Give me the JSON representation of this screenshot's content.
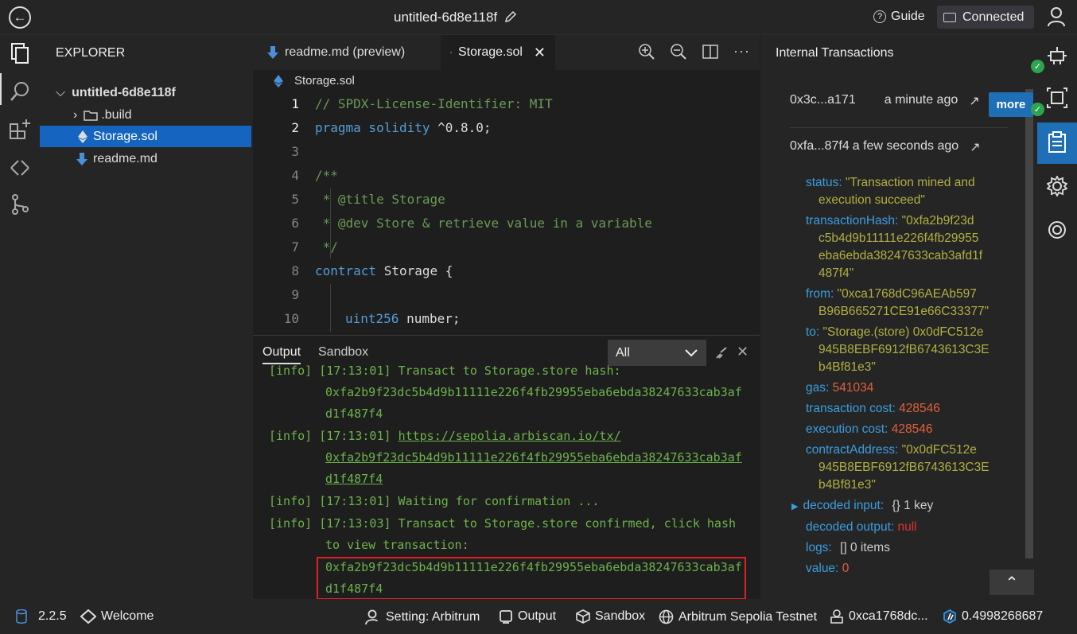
{
  "header": {
    "title": "untitled-6d8e118f",
    "guide_label": "Guide",
    "connected_label": "Connected"
  },
  "explorer": {
    "heading": "EXPLORER",
    "workspace": "untitled-6d8e118f",
    "items": [
      {
        "label": ".build"
      },
      {
        "label": "Storage.sol"
      },
      {
        "label": "readme.md"
      }
    ]
  },
  "tabs": [
    {
      "label": "readme.md (preview)"
    },
    {
      "label": "Storage.sol"
    }
  ],
  "editor": {
    "breadcrumb": "Storage.sol",
    "lines": [
      {
        "num": "1",
        "text": "// SPDX-License-Identifier: MIT"
      },
      {
        "num": "2",
        "kw": "pragma solidity",
        "text": " ^0.8.0;"
      },
      {
        "num": "3",
        "text": ""
      },
      {
        "num": "4",
        "text": "/**"
      },
      {
        "num": "5",
        "text": " * @title Storage"
      },
      {
        "num": "6",
        "text": " * @dev Store & retrieve value in a variable"
      },
      {
        "num": "7",
        "text": " */"
      },
      {
        "num": "8",
        "kw": "contract",
        "text": " Storage {"
      },
      {
        "num": "9",
        "text": ""
      },
      {
        "num": "10",
        "kw": "uint256",
        "text": " number;"
      }
    ]
  },
  "panel": {
    "tabs": [
      "Output",
      "Sandbox"
    ],
    "filter_value": "All",
    "log": {
      "l0": "[info] [17:13:01] Transact to Storage.store hash:",
      "l0a": "0xfa2b9f23dc5b4d9b11111e226f4fb29955eba6ebda38247633cab3af",
      "l0b": "d1f487f4",
      "l1_prefix": "[info] [17:13:01] ",
      "l1_link": "https://sepolia.arbiscan.io/tx/",
      "l1a": "0xfa2b9f23dc5b4d9b11111e226f4fb29955eba6ebda38247633cab3af",
      "l1b": "d1f487f4",
      "l2": "[info] [17:13:01] Waiting for confirmation ...",
      "l3": "[info] [17:13:03] Transact to Storage.store confirmed, click hash",
      "l3a": "to view transaction:",
      "l3b": "0xfa2b9f23dc5b4d9b11111e226f4fb29955eba6ebda38247633cab3af",
      "l3c": "d1f487f4"
    }
  },
  "internal_tx": {
    "heading": "Internal Transactions",
    "more_label": "more",
    "tx1": {
      "hash": "0x3c...a171",
      "time": "a minute ago"
    },
    "tx2": {
      "hash": "0xfa...87f4",
      "time": "a few seconds ago"
    },
    "details": {
      "status_k": "status:",
      "status_v1": "\"Transaction mined and",
      "status_v2": "execution succeed\"",
      "txhash_k": "transactionHash:",
      "txhash_v1": "\"0xfa2b9f23d",
      "txhash_v2": "c5b4d9b11111e226f4fb29955",
      "txhash_v3": "eba6ebda38247633cab3afd1f",
      "txhash_v4": "487f4\"",
      "from_k": "from:",
      "from_v1": "\"0xca1768dC96AEAb597",
      "from_v2": "B96B665271CE91e66C33377\"",
      "to_k": "to:",
      "to_v1": "\"Storage.(store) 0x0dFC512e",
      "to_v2": "945B8EBF6912fB6743613C3E",
      "to_v3": "b4Bf81e3\"",
      "gas_k": "gas:",
      "gas_v": "541034",
      "txcost_k": "transaction cost:",
      "txcost_v": "428546",
      "execcost_k": "execution cost:",
      "execcost_v": "428546",
      "ca_k": "contractAddress:",
      "ca_v1": "\"0x0dFC512e",
      "ca_v2": "945B8EBF6912fB6743613C3E",
      "ca_v3": "b4Bf81e3\"",
      "di_k": "decoded input:",
      "di_v": "{}  1 key",
      "do_k": "decoded output:",
      "do_v": "null",
      "logs_k": "logs:",
      "logs_v": "[]  0 items",
      "value_k": "value:",
      "value_v": "0"
    }
  },
  "statusbar": {
    "version": "2.2.5",
    "welcome": "Welcome",
    "setting": "Setting: Arbitrum",
    "output": "Output",
    "sandbox": "Sandbox",
    "network": "Arbitrum Sepolia Testnet",
    "account": "0xca1768dc...",
    "balance": "0.4998268687"
  }
}
